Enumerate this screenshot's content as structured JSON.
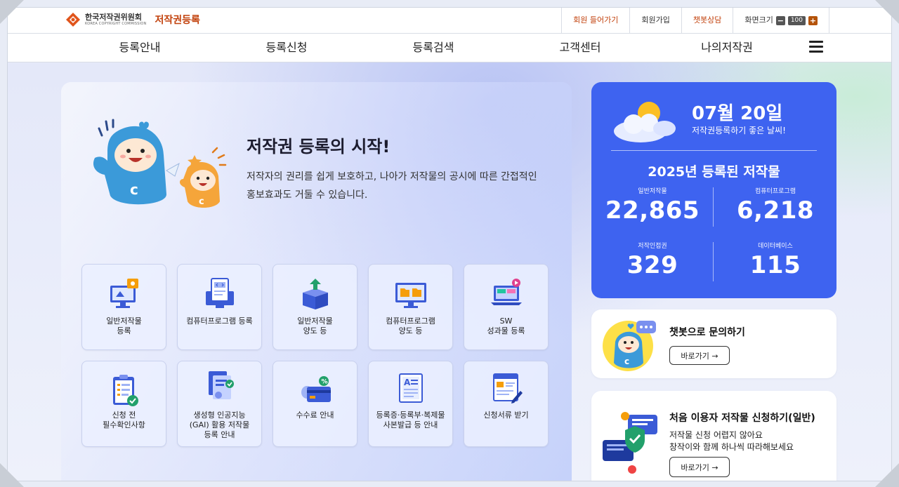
{
  "header": {
    "org_name": "한국저작권위원회",
    "org_name_en": "KOREA COPYRIGHT COMMISSION",
    "service_name": "저작권등록",
    "util_links": [
      "회원 들어가기",
      "회원가입",
      "챗봇상담"
    ],
    "zoom_label": "화면크기",
    "zoom_minus": "−",
    "zoom_value": "100",
    "zoom_plus": "+"
  },
  "nav": {
    "items": [
      "등록안내",
      "등록신청",
      "등록검색",
      "고객센터",
      "나의저작권"
    ]
  },
  "hero": {
    "title": "저작권 등록의 시작!",
    "description": "저작자의 권리를 쉽게 보호하고, 나아가 저작물의 공시에 따른 간접적인 홍보효과도 거둘 수 있습니다."
  },
  "tiles": [
    {
      "label": "일반저작물\n등록",
      "icon": "monitor-illustration-icon"
    },
    {
      "label": "컴퓨터프로그램 등록",
      "icon": "code-document-icon"
    },
    {
      "label": "일반저작물\n양도 등",
      "icon": "box-upload-icon"
    },
    {
      "label": "컴퓨터프로그램\n양도 등",
      "icon": "monitor-folders-icon"
    },
    {
      "label": "SW\n성과물 등록",
      "icon": "laptop-media-icon"
    },
    {
      "label": "신청 전\n필수확인사항",
      "icon": "clipboard-check-icon"
    },
    {
      "label": "생성형 인공지능\n(GAI) 활용 저작물\n등록 안내",
      "icon": "ai-document-icon"
    },
    {
      "label": "수수료 안내",
      "icon": "payment-card-icon"
    },
    {
      "label": "등록증·등록부·복제물\n사본발급 등 안내",
      "icon": "certificate-icon"
    },
    {
      "label": "신청서류 받기",
      "icon": "form-download-icon"
    }
  ],
  "stats": {
    "date": "07월 20일",
    "date_sub": "저작권등록하기 좋은 날씨!",
    "title": "2025년 등록된 저작물",
    "items": [
      {
        "label": "일반저작물",
        "value": "22,865"
      },
      {
        "label": "컴퓨터프로그램",
        "value": "6,218"
      },
      {
        "label": "저작인접권",
        "value": "329"
      },
      {
        "label": "데이터베이스",
        "value": "115"
      }
    ]
  },
  "chatbot": {
    "title": "챗봇으로 문의하기",
    "button": "바로가기 →"
  },
  "first_user": {
    "title": "처음 이용자 저작물 신청하기(일반)",
    "desc_line1": "저작물 신청 어렵지 않아요",
    "desc_line2": "창작이와 함께 하나씩 따라해보세요",
    "button": "바로가기 →"
  }
}
